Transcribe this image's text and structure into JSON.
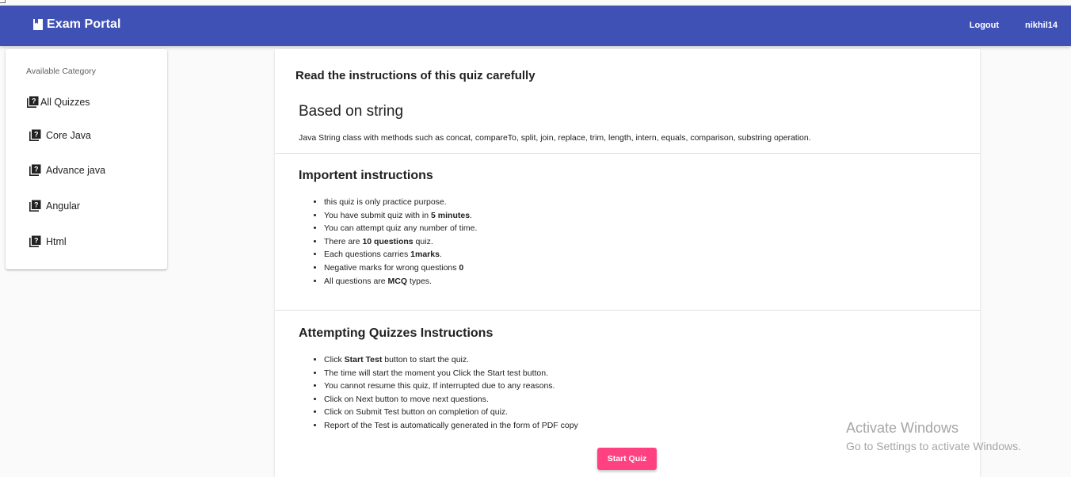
{
  "header": {
    "brand_icon": "book-icon",
    "title": "Exam Portal",
    "logout_label": "Logout",
    "username": "nikhil14",
    "color": "#3f51b5"
  },
  "sidebar": {
    "heading": "Available Category",
    "icon": "quiz-book-icon",
    "items": [
      {
        "label": "All Quizzes"
      },
      {
        "label": "Core Java"
      },
      {
        "label": "Advance java"
      },
      {
        "label": "Angular"
      },
      {
        "label": "Html"
      }
    ]
  },
  "main": {
    "heading": "Read the instructions of this quiz carefully",
    "quiz_title": "Based on string",
    "quiz_description": "Java String class with methods such as concat, compareTo, split, join, replace, trim, length, intern, equals, comparison, substring operation.",
    "important": {
      "title": "Importent instructions",
      "items": [
        {
          "pre": "this quiz is only practice purpose.",
          "bold": "",
          "post": ""
        },
        {
          "pre": "You have submit quiz with in ",
          "bold": "5 minutes",
          "post": "."
        },
        {
          "pre": "You can attempt quiz any number of time.",
          "bold": "",
          "post": ""
        },
        {
          "pre": "There are ",
          "bold": "10 questions",
          "post": " quiz."
        },
        {
          "pre": "Each questions carries ",
          "bold": "1marks",
          "post": "."
        },
        {
          "pre": "Negative marks for wrong questions ",
          "bold": "0",
          "post": ""
        },
        {
          "pre": "All questions are ",
          "bold": "MCQ",
          "post": " types."
        }
      ]
    },
    "attempting": {
      "title": "Attempting Quizzes Instructions",
      "items": [
        {
          "pre": "Click ",
          "bold": "Start Test",
          "post": " button to start the quiz."
        },
        {
          "pre": "The time will start the moment you Click the Start test button.",
          "bold": "",
          "post": ""
        },
        {
          "pre": "You cannot resume this quiz, If interrupted due to any reasons.",
          "bold": "",
          "post": ""
        },
        {
          "pre": "Click on Next button to move next questions.",
          "bold": "",
          "post": ""
        },
        {
          "pre": "Click on Submit Test button on completion of quiz.",
          "bold": "",
          "post": ""
        },
        {
          "pre": "Report of the Test is automatically generated in the form of PDF copy",
          "bold": "",
          "post": ""
        }
      ]
    },
    "start_button": "Start Quiz",
    "start_button_color": "#ff4081"
  },
  "watermark": {
    "line1": "Activate Windows",
    "line2": "Go to Settings to activate Windows."
  }
}
